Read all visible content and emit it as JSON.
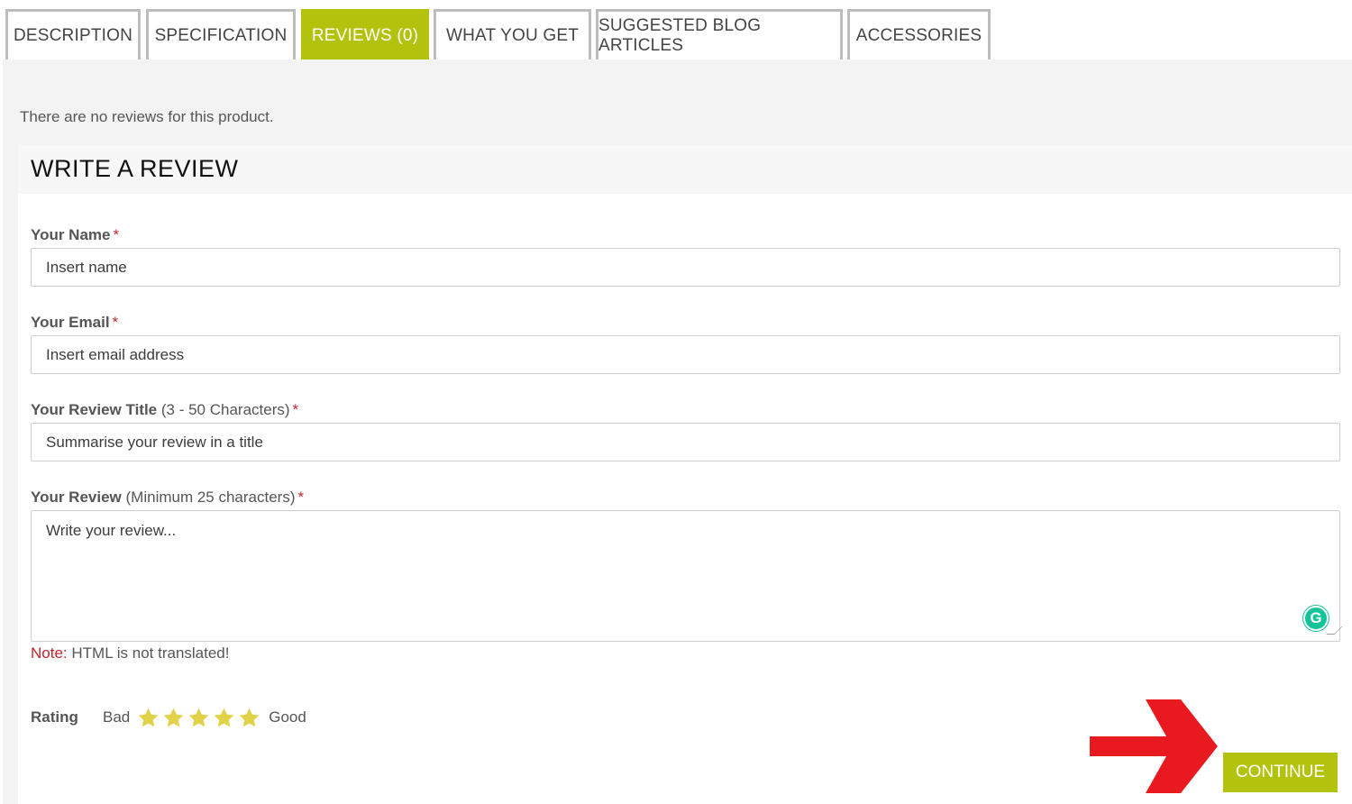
{
  "tabs": [
    {
      "label": "DESCRIPTION",
      "active": false
    },
    {
      "label": "SPECIFICATION",
      "active": false
    },
    {
      "label": "REVIEWS (0)",
      "active": true
    },
    {
      "label": "WHAT YOU GET",
      "active": false
    },
    {
      "label": "SUGGESTED BLOG ARTICLES",
      "active": false
    },
    {
      "label": "ACCESSORIES",
      "active": false
    }
  ],
  "no_reviews_text": "There are no reviews for this product.",
  "form": {
    "title": "WRITE A REVIEW",
    "name": {
      "label": "Your Name",
      "hint": "",
      "required_mark": "*",
      "placeholder": "Insert name"
    },
    "email": {
      "label": "Your Email",
      "hint": "",
      "required_mark": "*",
      "placeholder": "Insert email address"
    },
    "review_title": {
      "label": "Your Review Title",
      "hint": "(3 - 50 Characters)",
      "required_mark": "*",
      "placeholder": "Summarise your review in a title"
    },
    "review": {
      "label": "Your Review",
      "hint": "(Minimum 25 characters)",
      "required_mark": "*",
      "placeholder": "Write your review..."
    },
    "note": {
      "key": "Note:",
      "text": "HTML is not translated!"
    },
    "rating": {
      "label": "Rating",
      "low": "Bad",
      "high": "Good",
      "stars_total": 5
    },
    "grammarly_letter": "G",
    "continue_label": "CONTINUE"
  },
  "colors": {
    "accent": "#b3c20c",
    "required": "#c0262c",
    "star": "#e2d24a",
    "arrow": "#e8191f",
    "grammarly": "#15c39a"
  },
  "icons": {
    "star": "star-icon",
    "arrow": "arrow-right-icon",
    "grammarly": "grammarly-icon"
  }
}
